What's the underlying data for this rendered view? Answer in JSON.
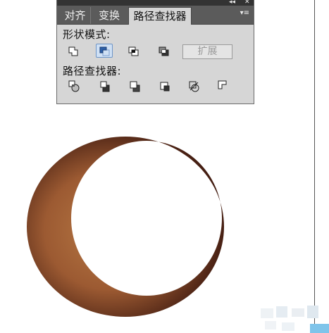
{
  "panel": {
    "tabs": [
      {
        "label": "对齐"
      },
      {
        "label": "变换"
      },
      {
        "label": "路径查找器"
      }
    ],
    "top_controls": {
      "collapse": "◂◂",
      "close": "✕"
    },
    "menu_icon": "≡",
    "shape_modes": {
      "label": "形状模式:",
      "buttons": [
        "unite-icon",
        "minus-front-icon",
        "intersect-icon",
        "exclude-icon"
      ],
      "selected": "minus-front-icon",
      "expand_label": "扩展"
    },
    "pathfinders": {
      "label": "路径查找器:",
      "buttons": [
        "divide-icon",
        "trim-icon",
        "merge-icon",
        "crop-icon",
        "outline-icon",
        "minus-back-icon"
      ]
    }
  },
  "artwork": {
    "shape": "crescent",
    "gradient": [
      "#3f1a10",
      "#9c5a32",
      "#b87a45"
    ]
  },
  "colors": {
    "panel_bg": "#d6d6d6",
    "tab_bar": "#5b5b5b",
    "selected_button": "#cfe0f4"
  }
}
